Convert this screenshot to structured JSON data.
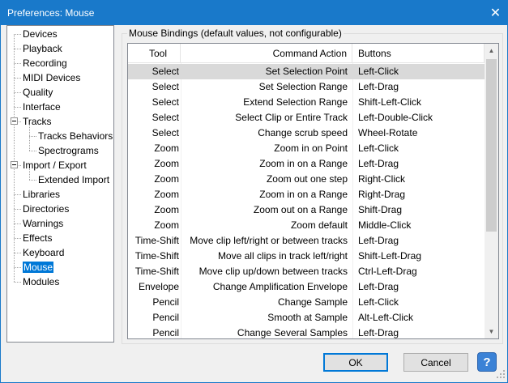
{
  "window": {
    "title": "Preferences: Mouse",
    "close_glyph": "✕"
  },
  "tree": {
    "items": [
      {
        "label": "Devices"
      },
      {
        "label": "Playback"
      },
      {
        "label": "Recording"
      },
      {
        "label": "MIDI Devices"
      },
      {
        "label": "Quality"
      },
      {
        "label": "Interface"
      },
      {
        "label": "Tracks",
        "expanded": true
      },
      {
        "label": "Tracks Behaviors"
      },
      {
        "label": "Spectrograms"
      },
      {
        "label": "Import / Export",
        "expanded": true
      },
      {
        "label": "Extended Import"
      },
      {
        "label": "Libraries"
      },
      {
        "label": "Directories"
      },
      {
        "label": "Warnings"
      },
      {
        "label": "Effects"
      },
      {
        "label": "Keyboard"
      },
      {
        "label": "Mouse",
        "selected": true
      },
      {
        "label": "Modules"
      }
    ]
  },
  "bindings": {
    "group_label": "Mouse Bindings (default values, not configurable)",
    "columns": {
      "tool": "Tool",
      "command": "Command Action",
      "buttons": "Buttons"
    },
    "rows": [
      [
        "Select",
        "Set Selection Point",
        "Left-Click"
      ],
      [
        "Select",
        "Set Selection Range",
        "Left-Drag"
      ],
      [
        "Select",
        "Extend Selection Range",
        "Shift-Left-Click"
      ],
      [
        "Select",
        "Select Clip or Entire Track",
        "Left-Double-Click"
      ],
      [
        "Select",
        "Change scrub speed",
        "Wheel-Rotate"
      ],
      [
        "Zoom",
        "Zoom in on Point",
        "Left-Click"
      ],
      [
        "Zoom",
        "Zoom in on a Range",
        "Left-Drag"
      ],
      [
        "Zoom",
        "Zoom out one step",
        "Right-Click"
      ],
      [
        "Zoom",
        "Zoom in on a Range",
        "Right-Drag"
      ],
      [
        "Zoom",
        "Zoom out on a Range",
        "Shift-Drag"
      ],
      [
        "Zoom",
        "Zoom default",
        "Middle-Click"
      ],
      [
        "Time-Shift",
        "Move clip left/right or between tracks",
        "Left-Drag"
      ],
      [
        "Time-Shift",
        "Move all clips in track left/right",
        "Shift-Left-Drag"
      ],
      [
        "Time-Shift",
        "Move clip up/down between tracks",
        "Ctrl-Left-Drag"
      ],
      [
        "Envelope",
        "Change Amplification Envelope",
        "Left-Drag"
      ],
      [
        "Pencil",
        "Change Sample",
        "Left-Click"
      ],
      [
        "Pencil",
        "Smooth at Sample",
        "Alt-Left-Click"
      ],
      [
        "Pencil",
        "Change Several Samples",
        "Left-Drag"
      ]
    ],
    "selected_row": 0
  },
  "buttons": {
    "ok": "OK",
    "cancel": "Cancel",
    "help": "?"
  },
  "icons": {
    "scroll_up": "up-arrow-icon",
    "scroll_down": "down-arrow-icon",
    "help": "help-icon",
    "close": "close-icon"
  },
  "colors": {
    "titlebar": "#1979ca",
    "selection": "#0078d7",
    "row_selected": "#d9d9d9"
  }
}
